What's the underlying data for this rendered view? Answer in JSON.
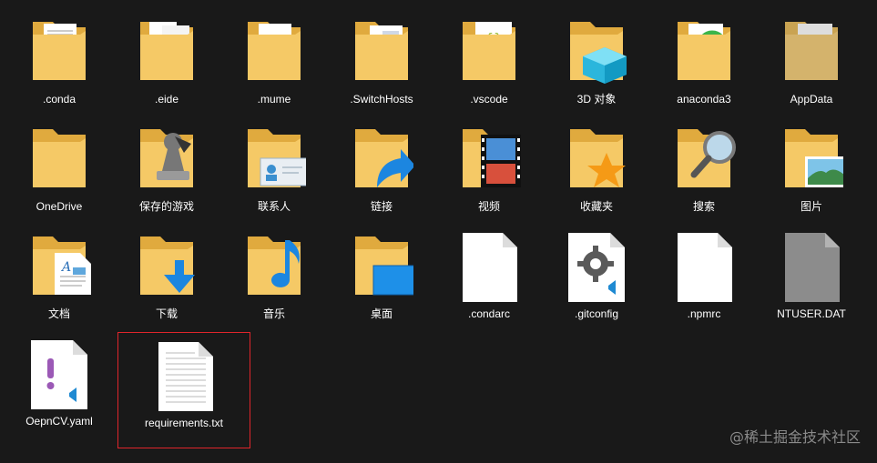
{
  "window": {
    "title": ""
  },
  "items": [
    {
      "label": ".conda",
      "icon": "folder-icon"
    },
    {
      "label": ".eide",
      "icon": "folder-icon"
    },
    {
      "label": ".mume",
      "icon": "folder-icon"
    },
    {
      "label": ".SwitchHosts",
      "icon": "folder-icon"
    },
    {
      "label": ".vscode",
      "icon": "folder-icon"
    },
    {
      "label": "3D 对象",
      "icon": "folder-3d-icon"
    },
    {
      "label": "anaconda3",
      "icon": "folder-icon"
    },
    {
      "label": "AppData",
      "icon": "folder-icon"
    },
    {
      "label": "OneDrive",
      "icon": "folder-icon"
    },
    {
      "label": "保存的游戏",
      "icon": "folder-games-icon"
    },
    {
      "label": "联系人",
      "icon": "folder-contacts-icon"
    },
    {
      "label": "链接",
      "icon": "folder-links-icon"
    },
    {
      "label": "视频",
      "icon": "folder-videos-icon"
    },
    {
      "label": "收藏夹",
      "icon": "folder-favorites-icon"
    },
    {
      "label": "搜索",
      "icon": "folder-search-icon"
    },
    {
      "label": "图片",
      "icon": "folder-pictures-icon"
    },
    {
      "label": "文档",
      "icon": "folder-documents-icon"
    },
    {
      "label": "下载",
      "icon": "folder-downloads-icon"
    },
    {
      "label": "音乐",
      "icon": "folder-music-icon"
    },
    {
      "label": "桌面",
      "icon": "folder-desktop-icon"
    },
    {
      "label": ".condarc",
      "icon": "file-icon"
    },
    {
      "label": ".gitconfig",
      "icon": "file-gear-icon"
    },
    {
      "label": ".npmrc",
      "icon": "file-icon"
    },
    {
      "label": "NTUSER.DAT",
      "icon": "file-gray-icon"
    },
    {
      "label": "OepnCV.yaml",
      "icon": "file-yaml-icon"
    },
    {
      "label": "requirements.txt",
      "icon": "file-text-icon",
      "selected": true
    }
  ],
  "colors": {
    "background": "#191919",
    "folder": "#f5c966",
    "folder_back": "#e0aa3e",
    "selection_border": "#e0252b"
  },
  "watermark": "@稀土掘金技术社区"
}
